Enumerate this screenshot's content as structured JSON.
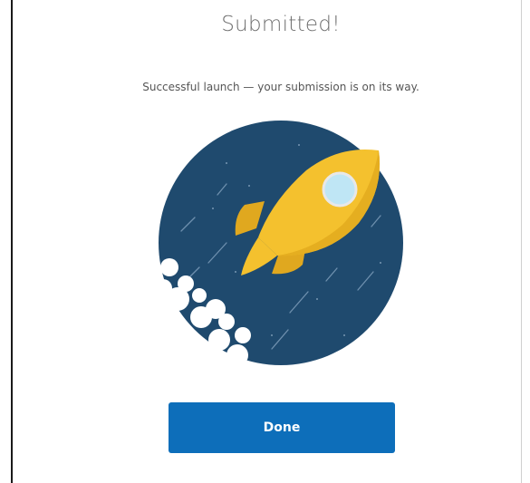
{
  "dialog": {
    "title": "Submitted!",
    "message": "Successful launch — your submission is on its way.",
    "illustration": "rocket-launch-icon",
    "done_label": "Done"
  },
  "colors": {
    "circle": "#1f4a6e",
    "rocket": "#f4c12e",
    "rocket_shadow": "#e0a81f",
    "window": "#bfe6f5",
    "button": "#0d6eba",
    "button_text": "#ffffff"
  }
}
